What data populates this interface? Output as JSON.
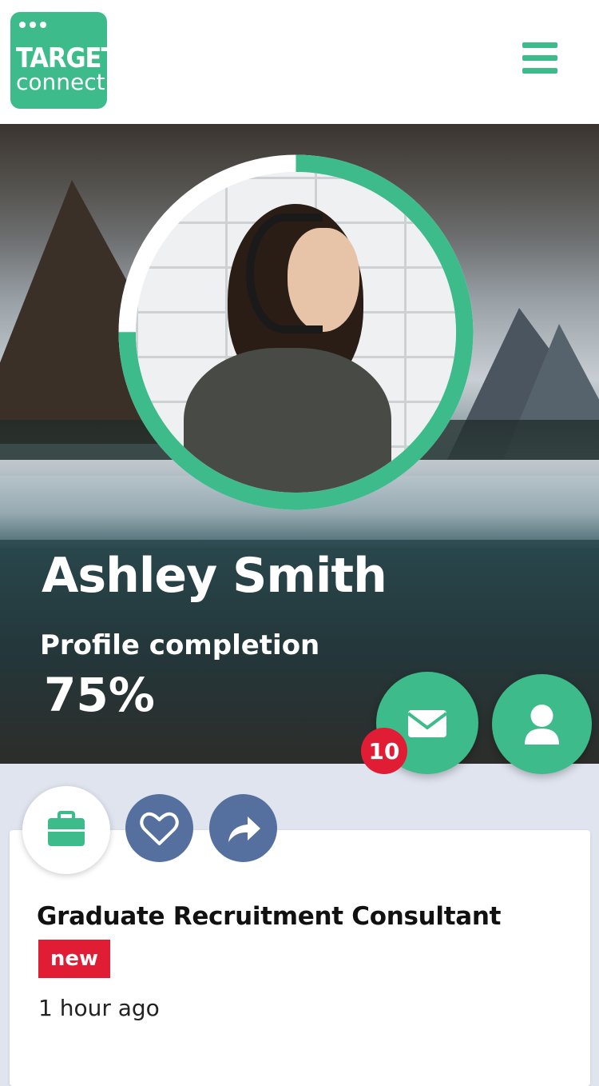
{
  "header": {
    "logo_line1": "TARGET",
    "logo_line2": "connect",
    "menu_icon": "hamburger-icon"
  },
  "profile": {
    "name": "Ashley Smith",
    "completion_label": "Profile completion",
    "completion_value": "75%",
    "completion_fraction": 0.75,
    "ring_color": "#3dbb8a"
  },
  "actions": {
    "messages_icon": "mail-icon",
    "messages_badge": "10",
    "profile_icon": "user-icon"
  },
  "card": {
    "icons": [
      "briefcase-icon",
      "heart-icon",
      "share-icon"
    ],
    "title": "Graduate Recruitment Consultant",
    "tag": "new",
    "time": "1 hour ago"
  },
  "colors": {
    "accent": "#3dbb8a",
    "secondary": "#55709e",
    "alert": "#e01d35"
  }
}
